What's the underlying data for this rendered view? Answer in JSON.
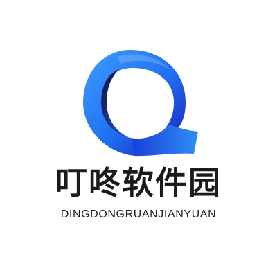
{
  "logo": {
    "icon": "blue-q-ribbon-icon",
    "title": "叮咚软件园",
    "subtitle": "DINGDONGRUANJIANYUAN",
    "colors": {
      "blue_light": "#3f9dff",
      "blue_mid": "#1f6ff0",
      "blue_dark": "#1a1ab8",
      "shadow": "#0b1240",
      "text": "#1a1a1a"
    }
  }
}
